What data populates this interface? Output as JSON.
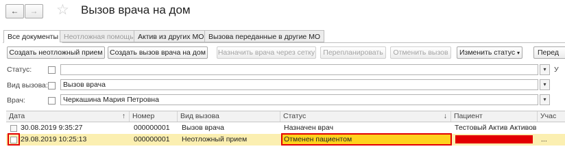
{
  "window": {
    "title": "Вызов врача на дом",
    "back_icon": "←",
    "forward_icon": "→",
    "favorite_icon": "☆"
  },
  "tabs": [
    {
      "label": "Все документы"
    },
    {
      "label": "Неотложная помощь"
    },
    {
      "label": "Актив из других МО"
    },
    {
      "label": "Вызова переданные в другие МО"
    }
  ],
  "toolbar": {
    "create_urgent": "Создать неотложный прием",
    "create_home_call": "Создать вызов врача на дом",
    "assign_doctor": "Назначить врача через сетку",
    "reschedule": "Перепланировать",
    "cancel_call": "Отменить вызов",
    "change_status": "Изменить статус",
    "more": "Перед"
  },
  "filters": {
    "status": {
      "label": "Статус:",
      "value": ""
    },
    "call_type": {
      "label": "Вид вызова:",
      "value": "Вызов врача"
    },
    "doctor": {
      "label": "Врач:",
      "value": "Черкашина Мария Петровна"
    },
    "extra_letter": "У"
  },
  "table": {
    "columns": [
      "Дата",
      "Номер",
      "Вид вызова",
      "Статус",
      "Пациент",
      "Учас"
    ],
    "sort_date_icon": "↑",
    "sort_status_icon": "↓",
    "rows": [
      {
        "date": "30.08.2019 9:35:27",
        "number": "000000001",
        "type": "Вызов врача",
        "status": "Назначен врач",
        "patient": "Тестовый Актив Активов...",
        "area": ""
      },
      {
        "date": "29.08.2019 10:25:13",
        "number": "000000001",
        "type": "Неотложный прием",
        "status": "Отменен пациентом",
        "patient": "",
        "area": "..."
      }
    ]
  },
  "colors": {
    "selected_row": "#fbefb1",
    "status_highlight": "#ffd21f",
    "annotation_red": "#e30000"
  }
}
